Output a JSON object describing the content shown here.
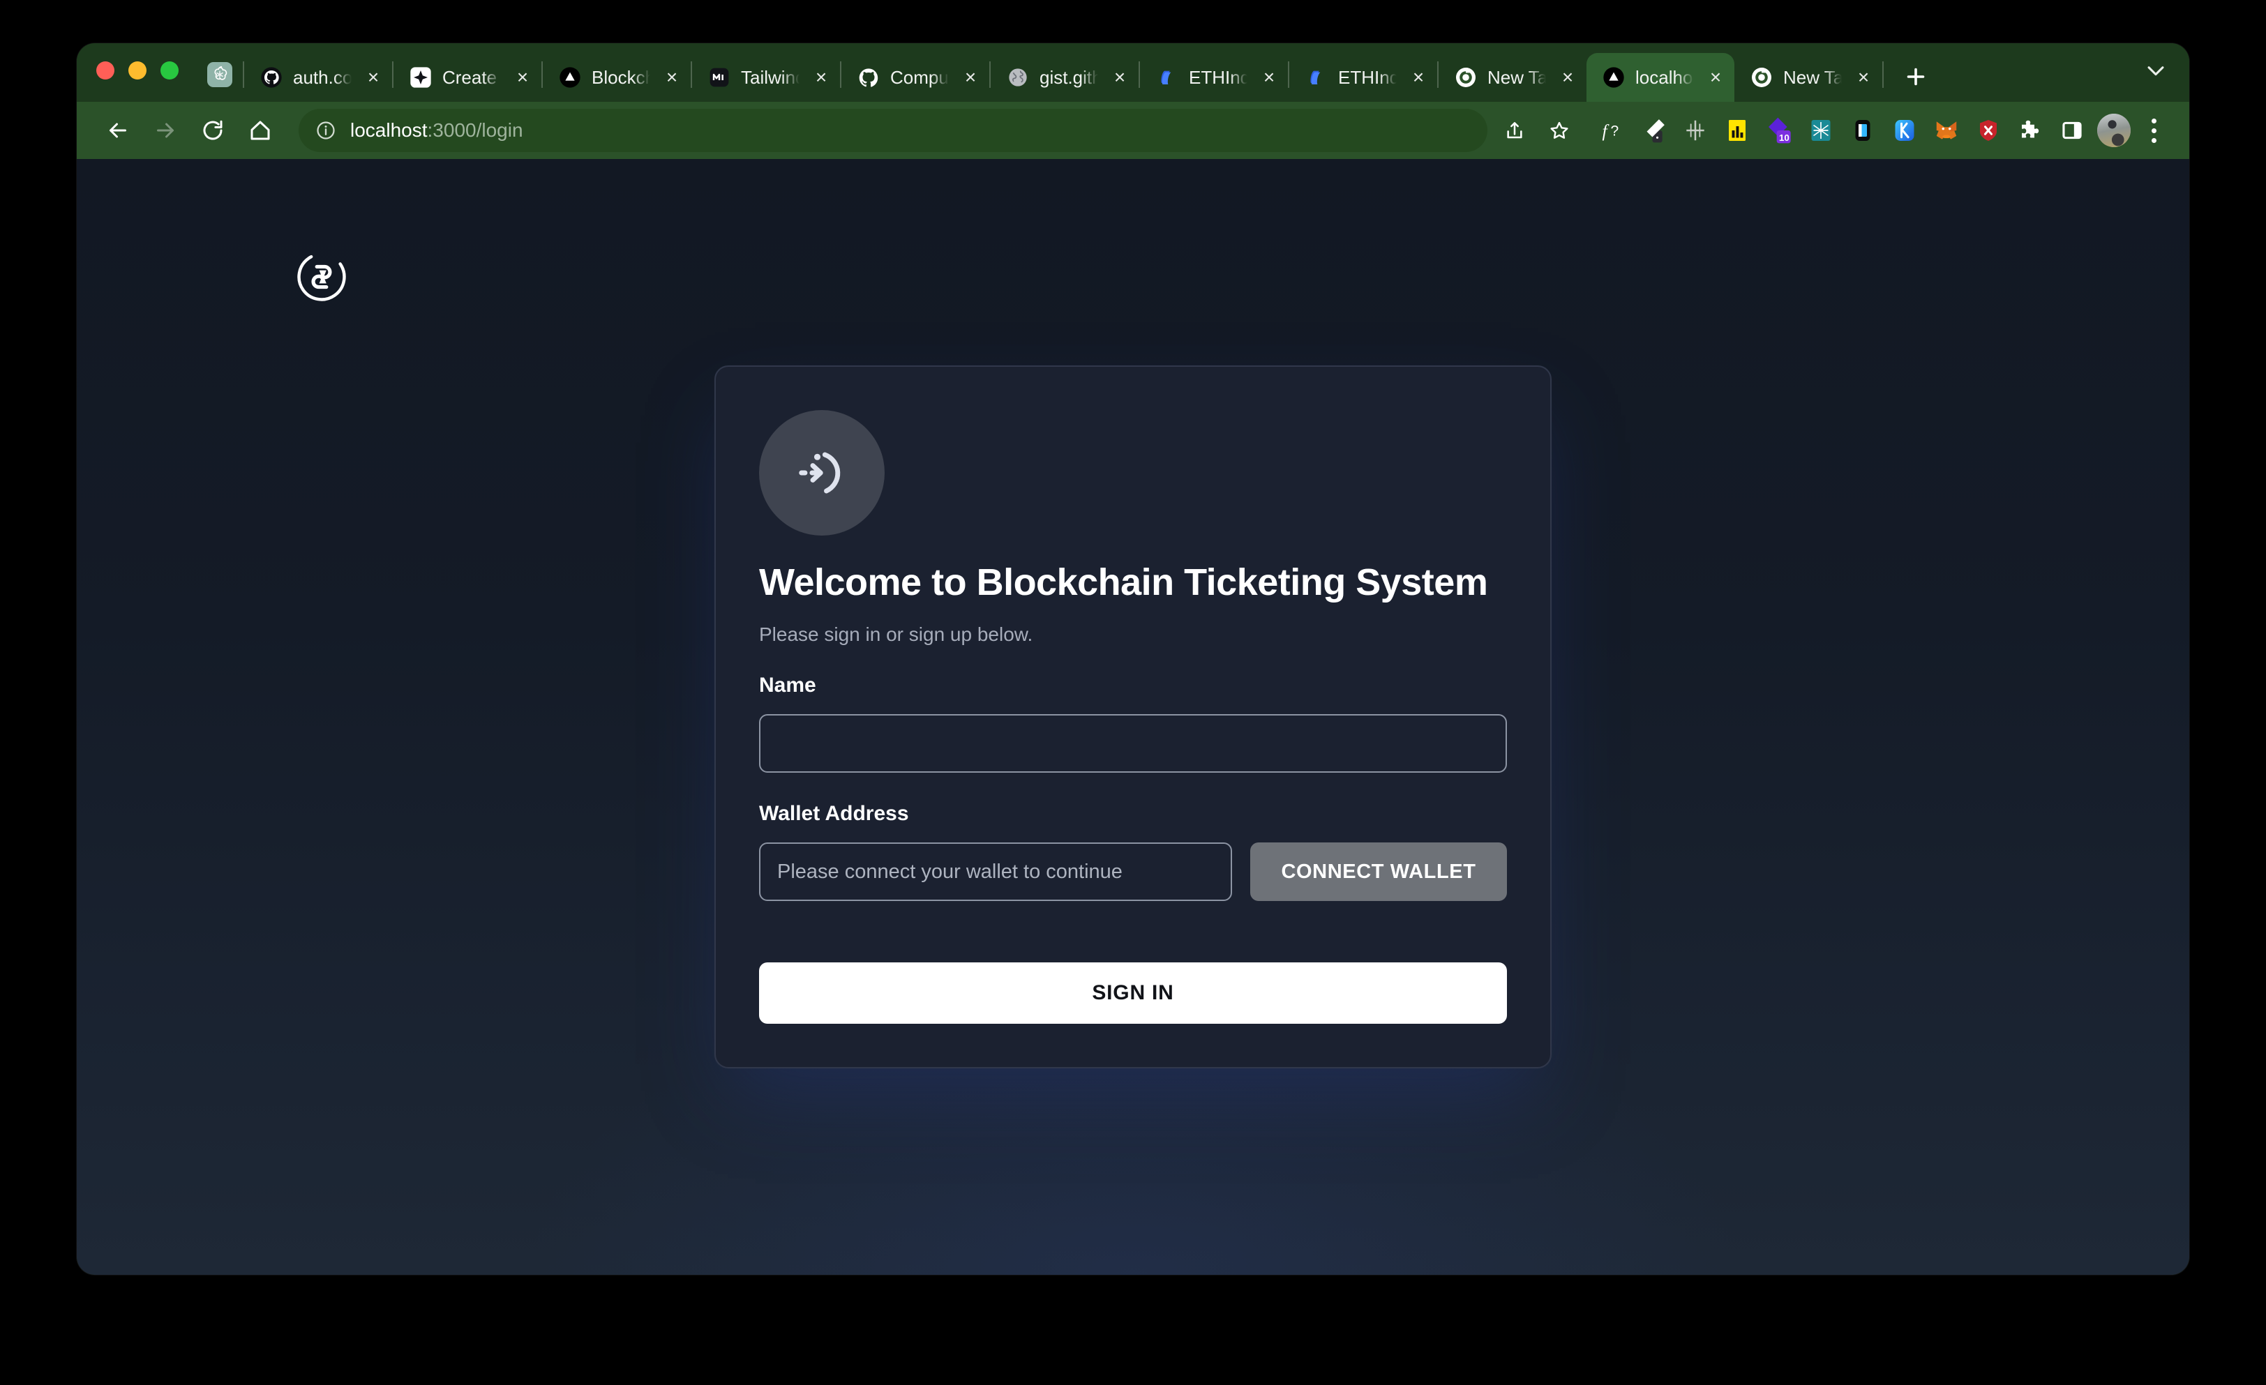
{
  "browser": {
    "traffic_lights": [
      "close",
      "minimize",
      "maximize"
    ],
    "tabs": [
      {
        "title": "auth.com",
        "favicon": "github-icon",
        "active": false
      },
      {
        "title": "Create E",
        "favicon": "vercel-diamond-icon",
        "active": false
      },
      {
        "title": "Blockch",
        "favicon": "vercel-triangle-icon",
        "active": false
      },
      {
        "title": "Tailwind",
        "favicon": "medium-m-icon",
        "active": false
      },
      {
        "title": "Comput",
        "favicon": "github-icon",
        "active": false
      },
      {
        "title": "gist.gith",
        "favicon": "globe-icon",
        "active": false
      },
      {
        "title": "ETHIndi",
        "favicon": "ethindia-blue-icon",
        "active": false
      },
      {
        "title": "ETHIndi",
        "favicon": "ethindia-blue-icon",
        "active": false
      },
      {
        "title": "New Tab",
        "favicon": "chrome-icon",
        "active": false
      },
      {
        "title": "localhos",
        "favicon": "vercel-triangle-icon",
        "active": true
      },
      {
        "title": "New Tab",
        "favicon": "chrome-icon",
        "active": false
      }
    ],
    "pinned_tab": {
      "favicon": "chatgpt-icon"
    },
    "new_tab_label": "+",
    "tab_close_label": "×",
    "tabstrip_chevron": "chevron-down-icon",
    "nav": {
      "back": "back-arrow-icon",
      "forward": "forward-arrow-icon",
      "reload": "reload-icon",
      "home": "home-icon"
    },
    "omnibox": {
      "info_icon": "info-circle-icon",
      "url_host": "localhost",
      "url_path": ":3000/login",
      "share_icon": "share-icon",
      "bookmark_icon": "star-icon"
    },
    "extensions": [
      "font-inspector-icon",
      "eyedropper-icon",
      "ruler-icon",
      "chart-yellow-icon",
      "purple-diamond-icon",
      "teal-web-icon",
      "device-toolbar-icon",
      "keplr-wallet-icon",
      "metamask-fox-icon",
      "red-x-icon"
    ],
    "extension_badge": "10",
    "extensions_puzzle_icon": "puzzle-icon",
    "side_panel_icon": "side-panel-icon",
    "profile_avatar": "user-avatar",
    "menu_icon": "kebab-menu-icon"
  },
  "page": {
    "site_logo": "blockchain-link-logo",
    "card": {
      "icon": "login-arrow-smiley-icon",
      "title": "Welcome to Blockchain Ticketing System",
      "subtitle": "Please sign in or sign up below.",
      "name_label": "Name",
      "name_value": "",
      "name_placeholder": "",
      "wallet_label": "Wallet Address",
      "wallet_value": "",
      "wallet_placeholder": "Please connect your wallet to continue",
      "connect_wallet_label": "CONNECT WALLET",
      "sign_in_label": "SIGN IN"
    }
  },
  "colors": {
    "chrome_tabstrip": "#1d3a1d",
    "chrome_toolbar": "#2b5229",
    "chrome_active_tab": "#2f6030",
    "omnibox_bg": "#24491f",
    "page_bg_top": "#121823",
    "page_bg_bottom": "#1e2836",
    "card_bg": "#1b2130",
    "card_border": "#30374a",
    "card_icon_bg": "#3f4450",
    "connect_btn_bg": "#6e7278",
    "signin_btn_bg": "#ffffff"
  }
}
